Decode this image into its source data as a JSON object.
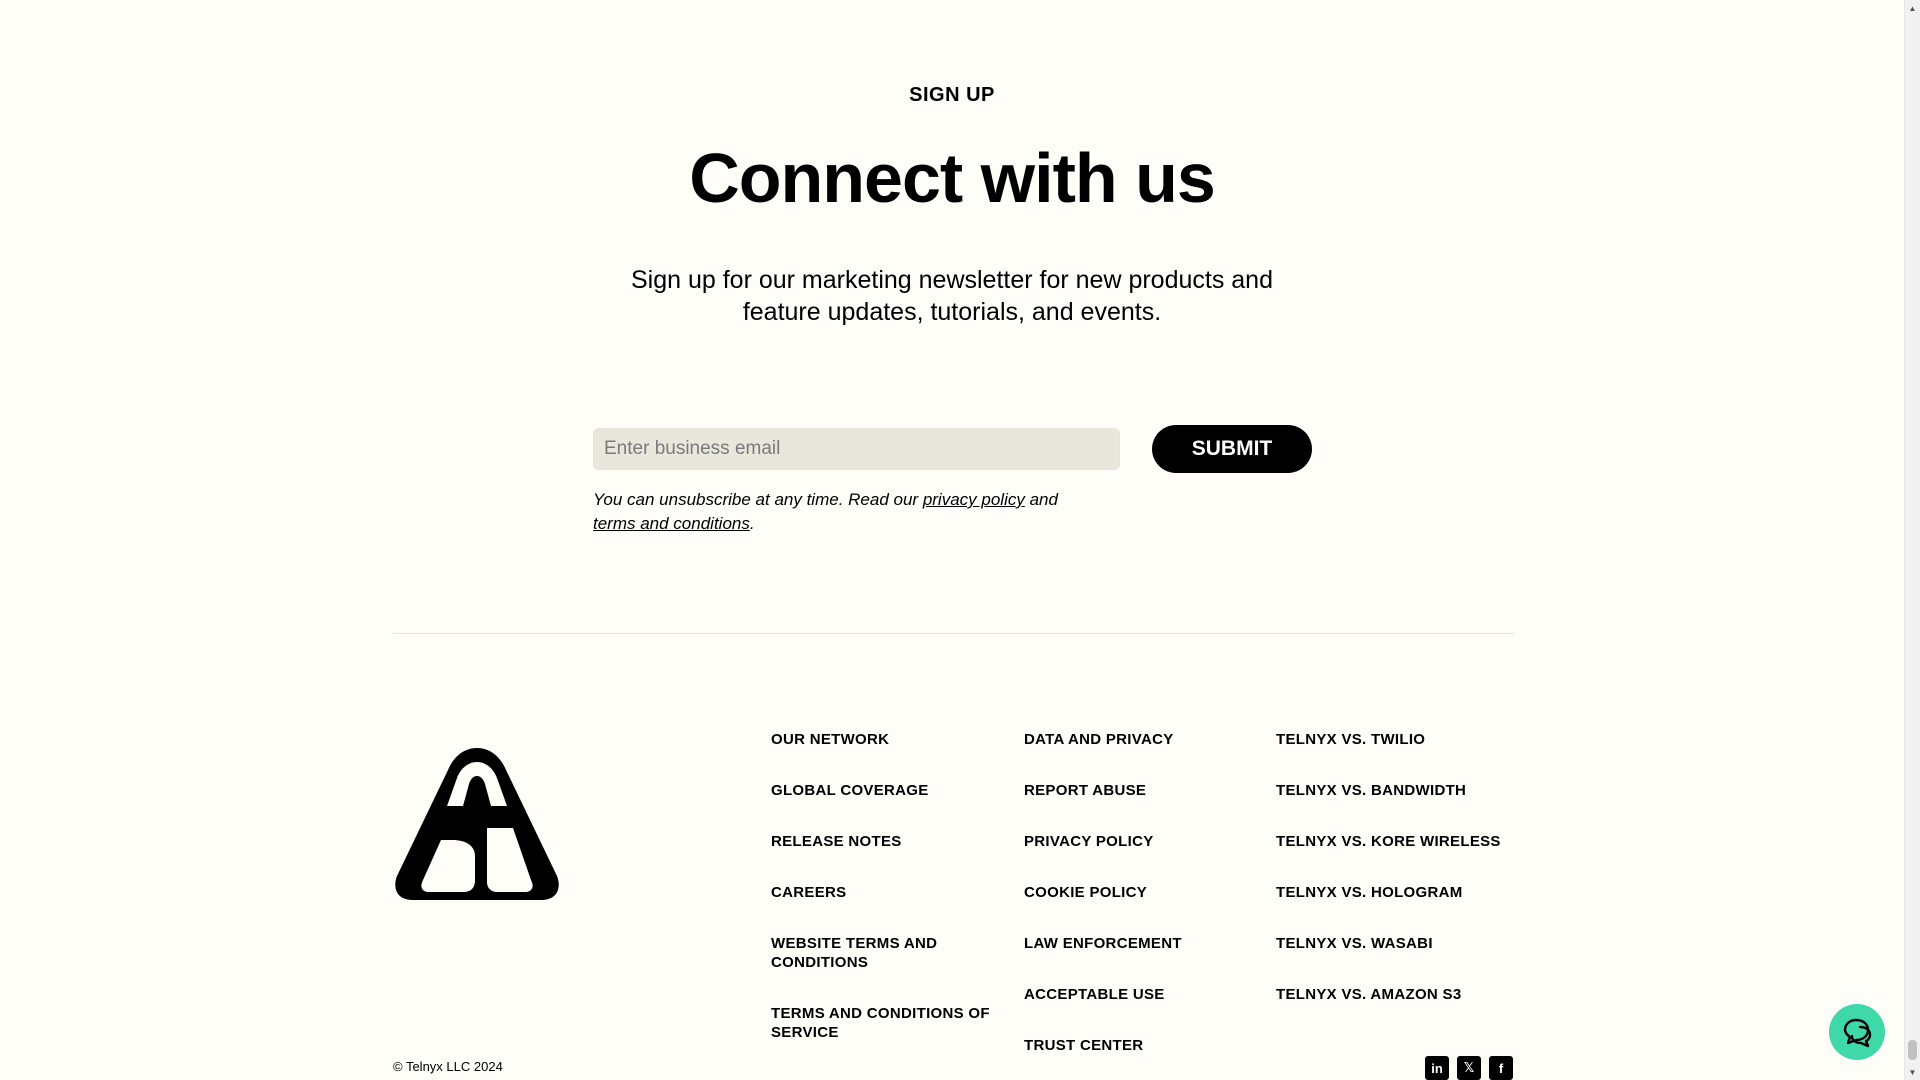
{
  "signup": {
    "eyebrow": "SIGN UP",
    "headline": "Connect with us",
    "subtext": "Sign up for our marketing newsletter for new products and feature updates, tutorials, and events.",
    "email_placeholder": "Enter business email",
    "email_value": "",
    "submit_label": "SUBMIT",
    "disclaimer_prefix": "You can unsubscribe at any time. Read our ",
    "privacy_link": "privacy policy",
    "disclaimer_mid": " and ",
    "terms_link": "terms and conditions",
    "disclaimer_suffix": "."
  },
  "footer": {
    "col1": [
      "OUR NETWORK",
      "GLOBAL COVERAGE",
      "RELEASE NOTES",
      "CAREERS",
      "WEBSITE TERMS AND CONDITIONS",
      "TERMS AND CONDITIONS OF SERVICE"
    ],
    "col2": [
      "DATA AND PRIVACY",
      "REPORT ABUSE",
      "PRIVACY POLICY",
      "COOKIE POLICY",
      "LAW ENFORCEMENT",
      "ACCEPTABLE USE",
      "TRUST CENTER"
    ],
    "col3": [
      "TELNYX VS. TWILIO",
      "TELNYX VS. BANDWIDTH",
      "TELNYX VS. KORE WIRELESS",
      "TELNYX VS. HOLOGRAM",
      "TELNYX VS. WASABI",
      "TELNYX VS. AMAZON S3"
    ],
    "copyright": "© Telnyx LLC 2024",
    "socials": [
      {
        "icon": "linkedin-icon",
        "glyph": "in"
      },
      {
        "icon": "x-icon",
        "glyph": "𝕏"
      },
      {
        "icon": "facebook-icon",
        "glyph": "f"
      }
    ]
  },
  "colors": {
    "background": "#fefdf8",
    "chat_button": "#3fd8a9",
    "input_background": "#e9e6dc"
  }
}
